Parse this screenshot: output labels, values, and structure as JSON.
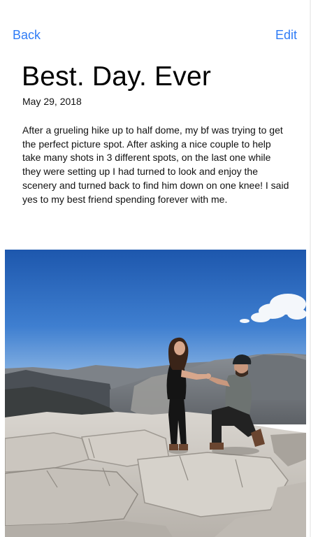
{
  "nav": {
    "back_label": "Back",
    "edit_label": "Edit"
  },
  "entry": {
    "title": "Best. Day. Ever",
    "date": "May 29, 2018",
    "body": "After a grueling hike up to half dome, my bf was trying to get the perfect picture spot. After asking a nice couple to help take many shots in 3 different spots, on the last one while they were setting up I had turned to look and enjoy the scenery and turned back to find him down on one knee! I said yes to my best friend spending forever with me."
  },
  "colors": {
    "accent": "#2f7cf6",
    "sky_top": "#1f5fb8",
    "sky_bottom": "#6fa3e0",
    "rock": "#c9c5bf"
  }
}
